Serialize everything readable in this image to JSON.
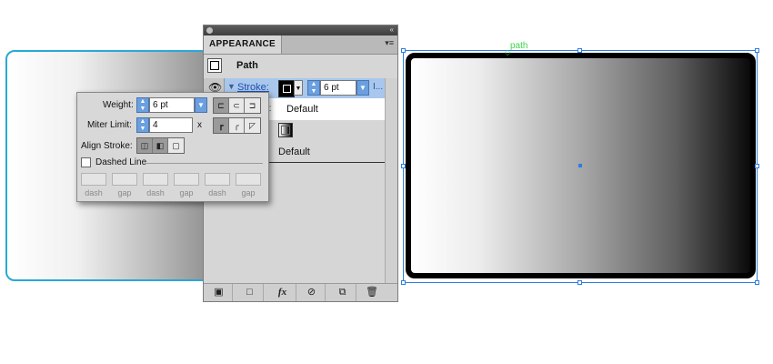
{
  "canvas": {
    "selection_label": "path",
    "colors": {
      "selection_blue": "#2e7de0",
      "left_outline_cyan": "#28a9d6",
      "path_label_green": "#3dd64a"
    }
  },
  "appearance_panel": {
    "tab_title": "APPEARANCE",
    "menu_icon": "panel-menu-icon",
    "path_title": "Path",
    "stroke": {
      "label": "Stroke:",
      "weight": "6 pt",
      "truncated": "I..."
    },
    "opacity": {
      "label_partial": "ty:",
      "value": "Default"
    },
    "fill_opacity_value": "Default",
    "toolbar_icons": [
      "add-new-stroke-icon",
      "add-new-fill-icon",
      "add-effect-icon",
      "clear-appearance-icon",
      "duplicate-item-icon",
      "delete-item-icon"
    ],
    "toolbar_glyphs": {
      "fx": "fx"
    }
  },
  "stroke_popup": {
    "weight_label": "Weight:",
    "weight_value": "6 pt",
    "miter_label": "Miter Limit:",
    "miter_value": "4",
    "miter_unit": "x",
    "align_label": "Align Stroke:",
    "dashed_label": "Dashed Line",
    "dash_labels": [
      "dash",
      "gap",
      "dash",
      "gap",
      "dash",
      "gap"
    ]
  }
}
